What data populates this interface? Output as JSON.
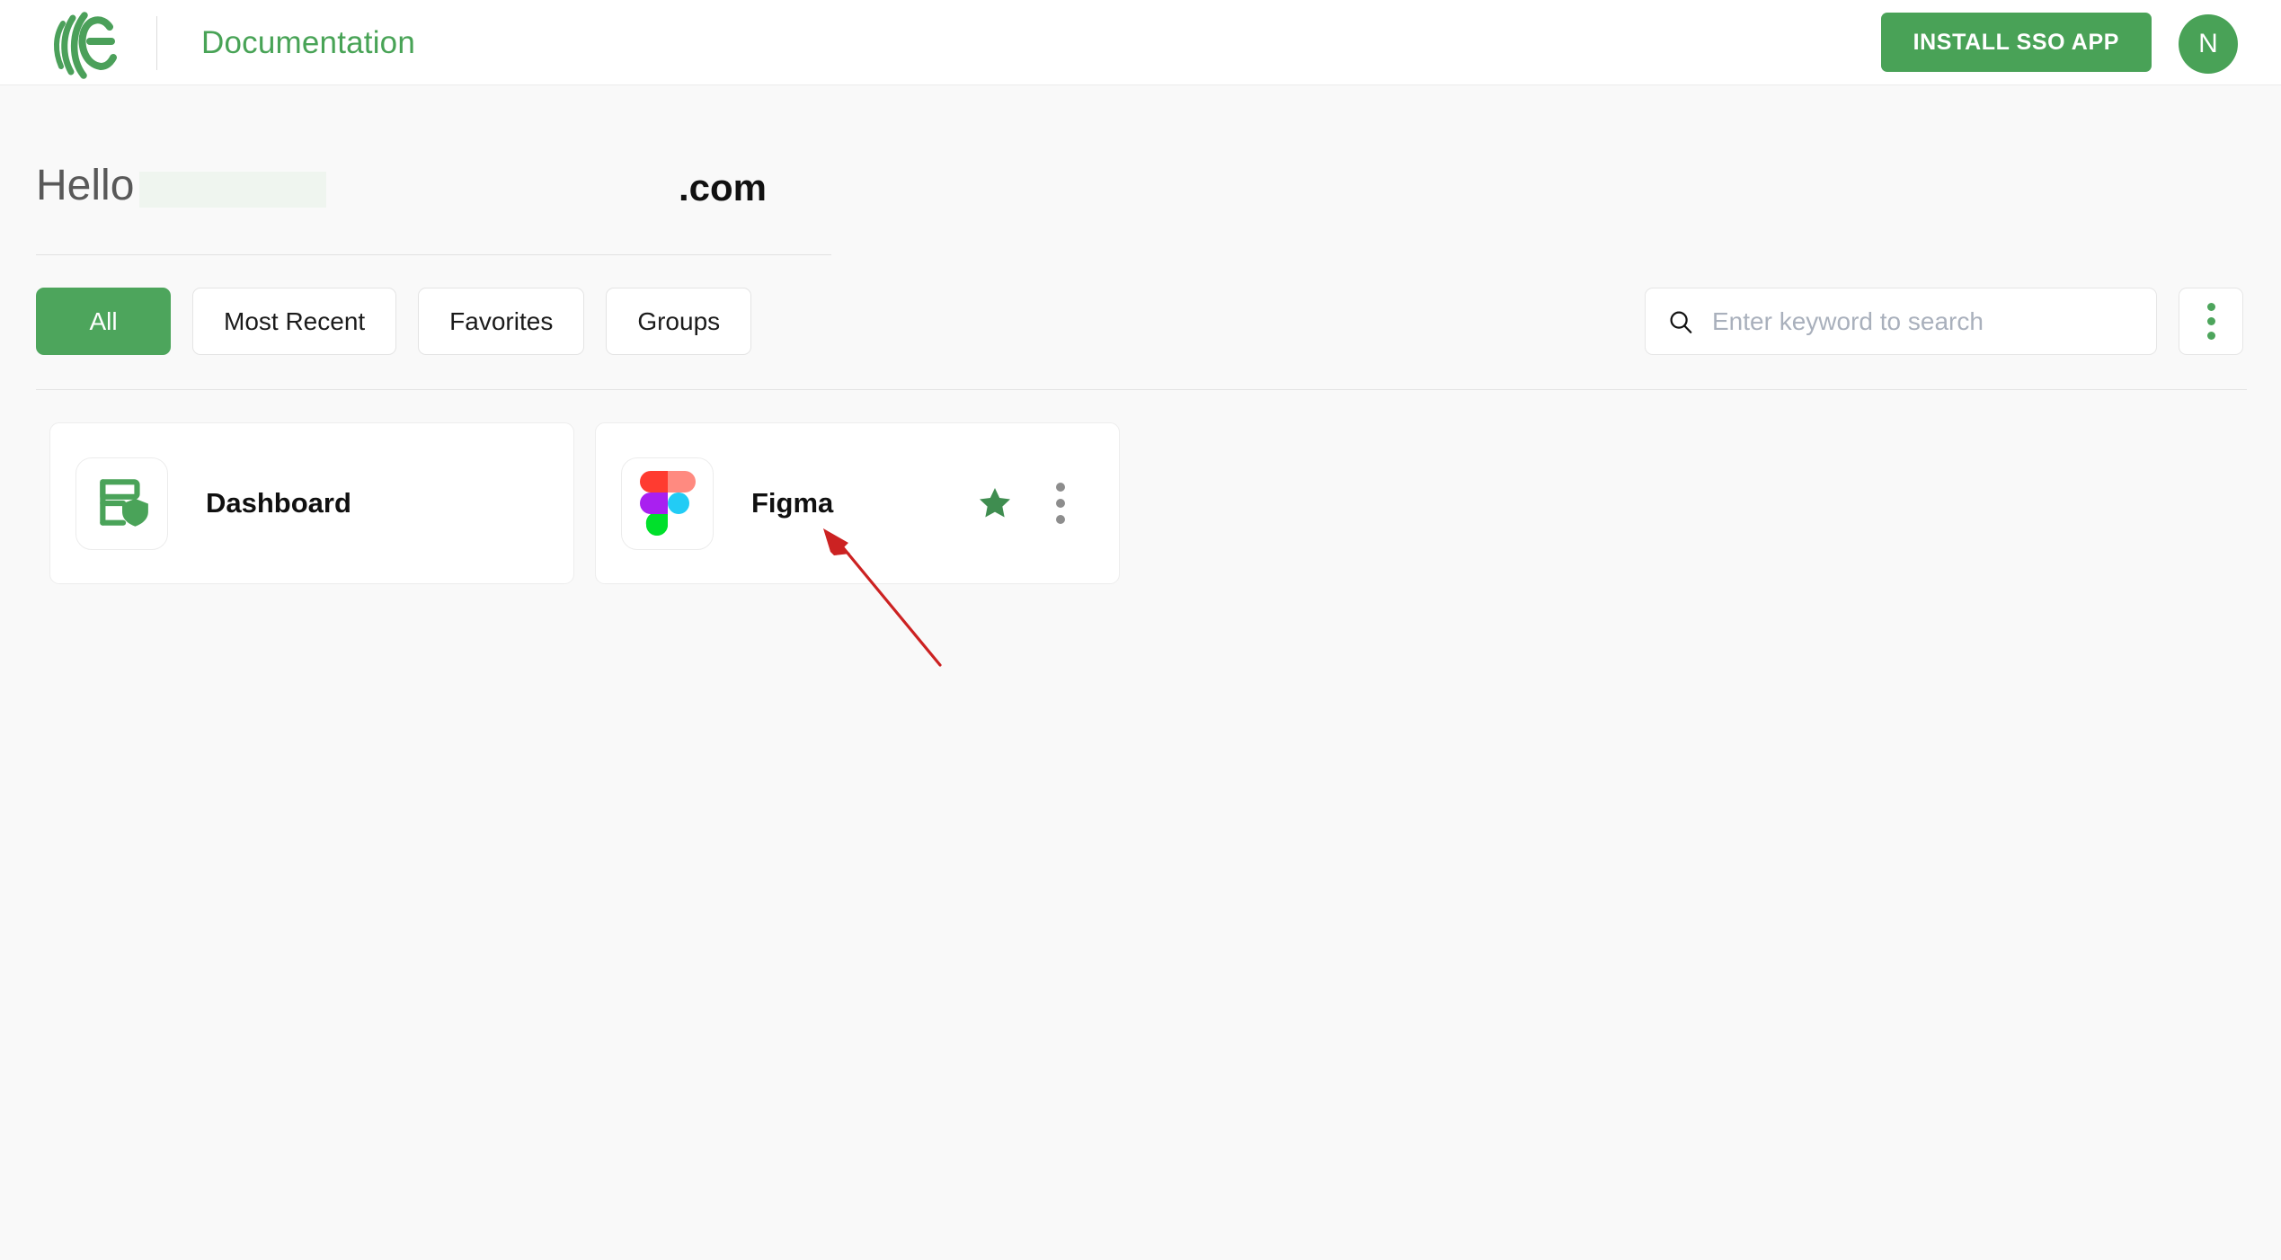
{
  "header": {
    "logo_icon": "miniorange-e-logo-icon",
    "title": "Documentation",
    "install_button": "INSTALL SSO APP",
    "avatar_initial": "N",
    "accent_color": "#49a257"
  },
  "greeting": {
    "hello": "Hello",
    "redacted_name": "",
    "domain": ".com"
  },
  "tabs": [
    {
      "label": "All",
      "active": true
    },
    {
      "label": "Most Recent",
      "active": false
    },
    {
      "label": "Favorites",
      "active": false
    },
    {
      "label": "Groups",
      "active": false
    }
  ],
  "search": {
    "placeholder": "Enter keyword to search",
    "value": "",
    "icon": "search-icon"
  },
  "toolbar": {
    "more_options_icon": "kebab-menu-icon"
  },
  "cards": [
    {
      "name": "Dashboard",
      "icon": "dashboard-shield-icon",
      "favorited": false,
      "has_menu": false
    },
    {
      "name": "Figma",
      "icon": "figma-logo-icon",
      "favorited": true,
      "has_menu": true
    }
  ],
  "annotation": {
    "type": "arrow",
    "color": "#cc2222",
    "points_to": "Figma"
  }
}
